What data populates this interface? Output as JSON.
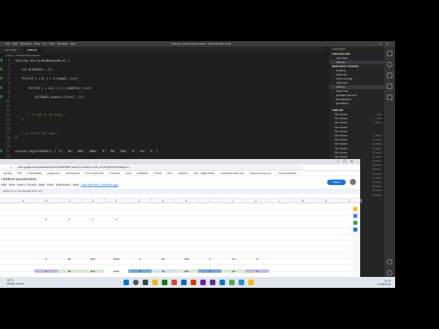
{
  "vscode": {
    "menu": [
      "File",
      "Edit",
      "Selection",
      "View",
      "Go",
      "Run",
      "Terminal",
      "Help"
    ],
    "window_title": "index.js - base-react-source - Visual Studio Code",
    "tabs": [
      "index.html",
      "index.js"
    ],
    "breadcrumb": "index.js > sherlockAndAnagrams",
    "lines": [
      {
        "n": "1",
        "code": "function sherlockAndAnagrams(s) {"
      },
      {
        "n": "2",
        "code": ""
      },
      {
        "n": "3",
        "code": "    let allSubStr = [];"
      },
      {
        "n": "4",
        "code": ""
      },
      {
        "n": "5",
        "code": "    for(let i = 0; i < s.length; i++){"
      },
      {
        "n": "6",
        "code": ""
      },
      {
        "n": "7",
        "code": "        for(let j = i+1; j < s.length+1; j++){"
      },
      {
        "n": "8",
        "code": ""
      },
      {
        "n": "9",
        "code": "            allSubStr.push(s.slice(i, j));"
      },
      {
        "n": "10",
        "code": ""
      },
      {
        "n": "11",
        "code": ""
      },
      {
        "n": "12",
        "code": ""
      },
      {
        "n": "13",
        "code": "        } // end of for loop j"
      },
      {
        "n": "14",
        "code": "    }"
      },
      {
        "n": "15",
        "code": ""
      },
      {
        "n": "16",
        "code": ""
      },
      {
        "n": "17",
        "code": "    } // end of for loop i"
      },
      {
        "n": "18",
        "code": "}"
      },
      {
        "n": "19",
        "code": ""
      },
      {
        "n": "20",
        "code": ""
      },
      {
        "n": "21",
        "code": "console.log(allSubStr); [ 'a', 'ab', 'abb', 'abba', 'b', 'bb', 'bba', 'b', 'ba', 'a' ]"
      },
      {
        "n": "22",
        "code": ""
      },
      {
        "n": "23",
        "code": "// arrange alphabetically"
      },
      {
        "n": "24",
        "code": ""
      },
      {
        "n": "25",
        "code": "let finalArr = allSubStr.map(el=> el.split('').sort().join(''));"
      },
      {
        "n": "26",
        "code": "console.log(finalArr); [ 'a', 'ab', 'abb', 'aabb', 'b', 'bb', 'abb', 'b', 'ab', 'a' ]"
      }
    ],
    "explorer_header": "EXPLORER",
    "open_editors": "OPEN EDITORS",
    "open_files": [
      "index.html",
      "index.js"
    ],
    "project": "BASE-REACT-SOURCE",
    "files": [
      "helper.js",
      "index.css",
      "index.css.map",
      "index.html",
      "index.js",
      "index.scss",
      "package-lock.json",
      "package.json",
      "priorities.js"
    ],
    "timeline_header": "TIMELINE",
    "timeline": [
      {
        "label": "File Saved",
        "ago": "now"
      },
      {
        "label": "File Saved",
        "ago": "1 min"
      },
      {
        "label": "File Saved",
        "ago": "2 mins"
      },
      {
        "label": "File Saved",
        "ago": ""
      },
      {
        "label": "File Saved",
        "ago": ""
      },
      {
        "label": "File Saved",
        "ago": "6 mins"
      },
      {
        "label": "File Saved",
        "ago": "10 mins"
      },
      {
        "label": "File Saved",
        "ago": "12 mins"
      },
      {
        "label": "File Saved",
        "ago": "15 mins"
      },
      {
        "label": "File Saved",
        "ago": "19 mins"
      },
      {
        "label": "File Saved",
        "ago": "22 mins"
      },
      {
        "label": "File Saved",
        "ago": "26 mins"
      },
      {
        "label": "File Saved",
        "ago": "29 mins"
      },
      {
        "label": "File Saved",
        "ago": "33 mins"
      },
      {
        "label": "File Saved",
        "ago": "38 mins"
      },
      {
        "label": "File Saved",
        "ago": "41 mins"
      },
      {
        "label": "File Saved",
        "ago": "44 mins"
      },
      {
        "label": "File Saved",
        "ago": "48 mins"
      },
      {
        "label": "File Saved",
        "ago": "52 mins"
      },
      {
        "label": "File Saved",
        "ago": "56 mins"
      }
    ],
    "status": "Ln 1, Col 1  Spaces: 2  UTF-8  LF  JavaScript",
    "accent": "#007acc"
  },
  "chrome": {
    "url": "docs.google.com/spreadsheets/d/1HWdNDMBhYsauCIK-Ou0szErct-CMt_evCkIPgeZ9ZQI/edit#gid=0",
    "bookmarks": [
      "Job stuff",
      "PDF",
      "FinancialMds",
      "google docs",
      "Development",
      "Fun & other Stuff",
      "7 Seconds",
      "Docs",
      "GoalWriter",
      "7Points",
      "IDeo",
      "CodeGen",
      "Cost - Single Studio",
      "CodeMode Mixes only",
      "Ospeu fit strong coc...",
      "FocusTubeMusic"
    ],
    "doc_title": "Untitled spreadsheet",
    "menu": [
      "Edit",
      "View",
      "Insert",
      "Format",
      "Data",
      "Tools",
      "Extensions",
      "Help"
    ],
    "last_edit": "Last edit was 4 minutes ago",
    "share": "Share",
    "toolbar": "100%   $   %   .0   .00   123   Arial   10   B   I   S   A",
    "columns": [
      "A",
      "B",
      "C",
      "D",
      "E",
      "F",
      "G",
      "H",
      "I",
      "J",
      "K",
      "L",
      "M",
      "N",
      "O"
    ],
    "row_top": [
      "a",
      "b",
      "o",
      "a"
    ],
    "row_substr": [
      "a",
      "ab",
      "abb",
      "abba",
      "b",
      "bb",
      "bba",
      "b",
      "ba",
      "a"
    ],
    "row_sorted": [
      "a",
      "ab",
      "abb",
      "aabb",
      "b",
      "bb",
      "abb",
      "b",
      "ab",
      "a"
    ],
    "share_color": "#1a73e8"
  },
  "taskbar": {
    "weather_temp": "14°C",
    "weather_desc": "Mostly cloudy",
    "time": "12:22",
    "date": "07/06/2022"
  }
}
